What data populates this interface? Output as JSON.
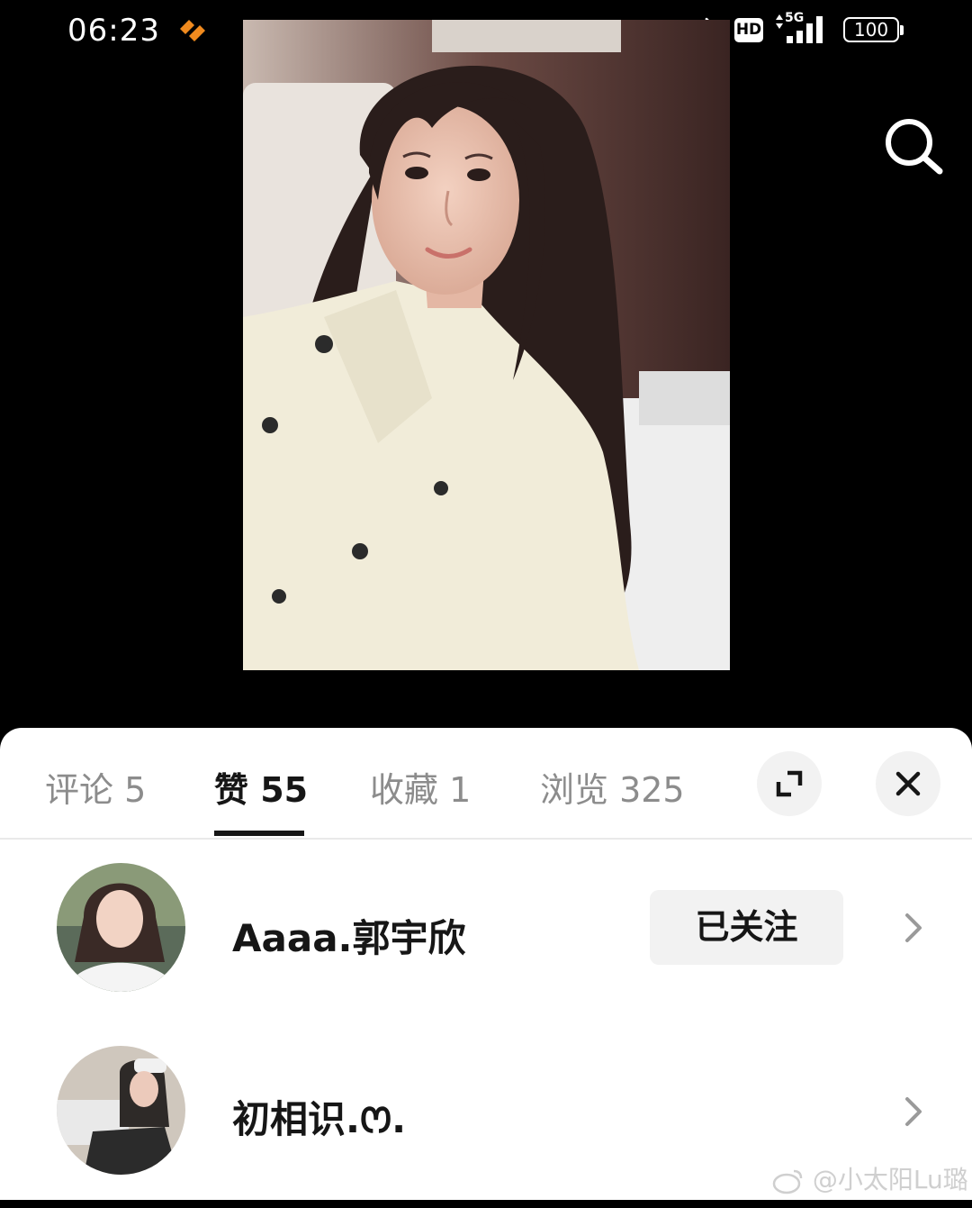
{
  "status_bar": {
    "time": "06:23",
    "hd_label": "HD",
    "network_label": "5G",
    "battery": "100",
    "icons": [
      "app-badge-icon",
      "bluetooth-icon",
      "signal-icon",
      "battery-icon"
    ]
  },
  "viewer": {
    "search_icon": "search-icon",
    "photo_subject": "photo"
  },
  "sheet": {
    "tabs": [
      {
        "label": "评论 5"
      },
      {
        "label": "赞 55"
      },
      {
        "label": "收藏 1"
      },
      {
        "label": "浏览 325"
      }
    ],
    "active_tab_index": 1,
    "expand_icon": "expand-icon",
    "close_icon": "close-icon",
    "likers": [
      {
        "name": "Aaaa.郭宇欣",
        "follow_label": "已关注"
      },
      {
        "name": "初相识.ꯁ."
      }
    ]
  },
  "watermark": {
    "text": "@小太阳Lu璐"
  },
  "colors": {
    "background": "#000000",
    "sheet": "#ffffff",
    "active_tab": "#161616",
    "inactive_tab": "#8c8c8c",
    "button_bg": "#f2f2f2",
    "app_badge": "#f08a1e"
  }
}
